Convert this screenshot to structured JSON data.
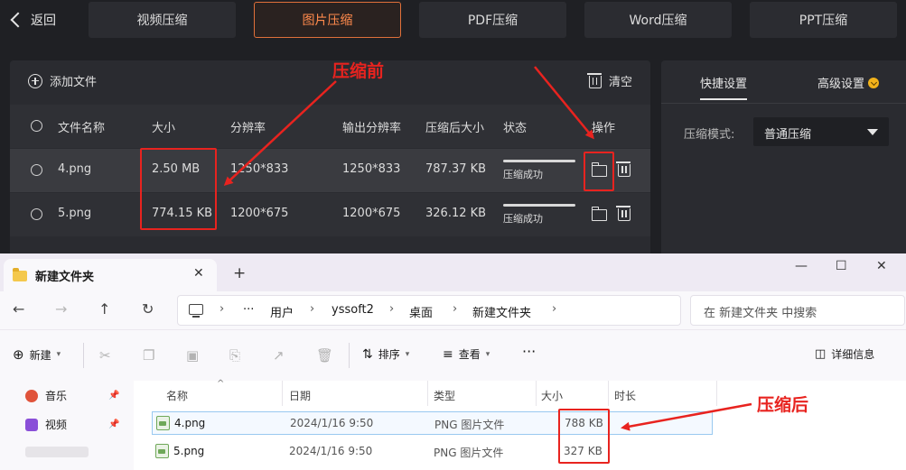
{
  "app": {
    "back_label": "返回",
    "tabs": [
      {
        "label": "视频压缩"
      },
      {
        "label": "图片压缩",
        "active": true
      },
      {
        "label": "PDF压缩"
      },
      {
        "label": "Word压缩"
      },
      {
        "label": "PPT压缩"
      }
    ],
    "add_file_label": "添加文件",
    "clear_label": "清空",
    "columns": [
      "文件名称",
      "大小",
      "分辨率",
      "输出分辨率",
      "压缩后大小",
      "状态",
      "操作"
    ],
    "rows": [
      {
        "name": "4.png",
        "size": "2.50 MB",
        "resolution": "1250*833",
        "output_resolution": "1250*833",
        "compressed_size": "787.37 KB",
        "status": "压缩成功"
      },
      {
        "name": "5.png",
        "size": "774.15 KB",
        "resolution": "1200*675",
        "output_resolution": "1200*675",
        "compressed_size": "326.12 KB",
        "status": "压缩成功"
      }
    ],
    "settings": {
      "quick_tab": "快捷设置",
      "advanced_tab": "高级设置",
      "mode_label": "压缩模式:",
      "mode_value": "普通压缩"
    }
  },
  "explorer": {
    "tab_title": "新建文件夹",
    "breadcrumb": [
      "用户",
      "yssoft2",
      "桌面",
      "新建文件夹"
    ],
    "search_placeholder": "在 新建文件夹 中搜索",
    "toolbar": {
      "new_label": "新建",
      "sort_label": "排序",
      "view_label": "查看",
      "details_label": "详细信息"
    },
    "sidebar": [
      {
        "label": "音乐",
        "icon": "music-icon"
      },
      {
        "label": "视频",
        "icon": "video-icon"
      }
    ],
    "columns": [
      "名称",
      "日期",
      "类型",
      "大小",
      "时长"
    ],
    "files": [
      {
        "name": "4.png",
        "date": "2024/1/16 9:50",
        "type": "PNG 图片文件",
        "size": "788 KB"
      },
      {
        "name": "5.png",
        "date": "2024/1/16 9:50",
        "type": "PNG 图片文件",
        "size": "327 KB"
      }
    ]
  },
  "annotations": {
    "before_label": "压缩前",
    "after_label": "压缩后",
    "color": "#e8231f"
  }
}
